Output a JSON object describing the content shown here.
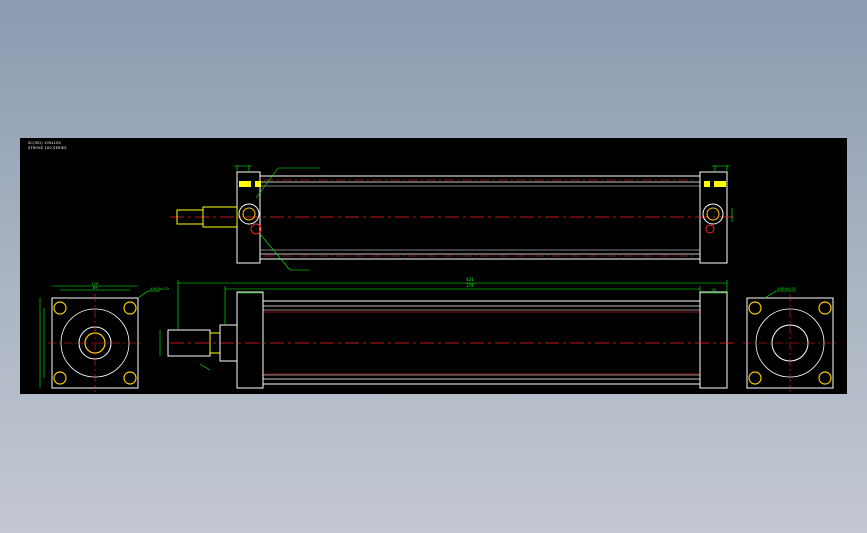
{
  "title_block": {
    "line1": "SC(ISO) 100x100",
    "line2": "STROKE 100 SERIES"
  },
  "colors": {
    "background": "#000000",
    "outline": "#ffffff",
    "dimension": "#00ff00",
    "centerline": "#ff2020",
    "rod": "#ffff00",
    "bolt": "#ffcc00"
  },
  "top_view": {
    "labels": [
      "G 1/4",
      "M6x1"
    ],
    "callouts": [
      "4-G 1/4\"",
      "4 PORTS",
      "CUSHION",
      "ADJ SCREW"
    ]
  },
  "bottom_view": {
    "overall_dimension": "421",
    "stroke_dimension": "374",
    "left_dims": [
      "43",
      "20",
      "38"
    ],
    "right_dim": "20",
    "rod_dims": [
      "M20",
      "Ø20"
    ]
  },
  "left_end_view": {
    "width": "110",
    "bolt_spacing": "89",
    "callout": "4-M10x1.25"
  },
  "right_end_view": {
    "callout": "4-M10x1.25"
  }
}
